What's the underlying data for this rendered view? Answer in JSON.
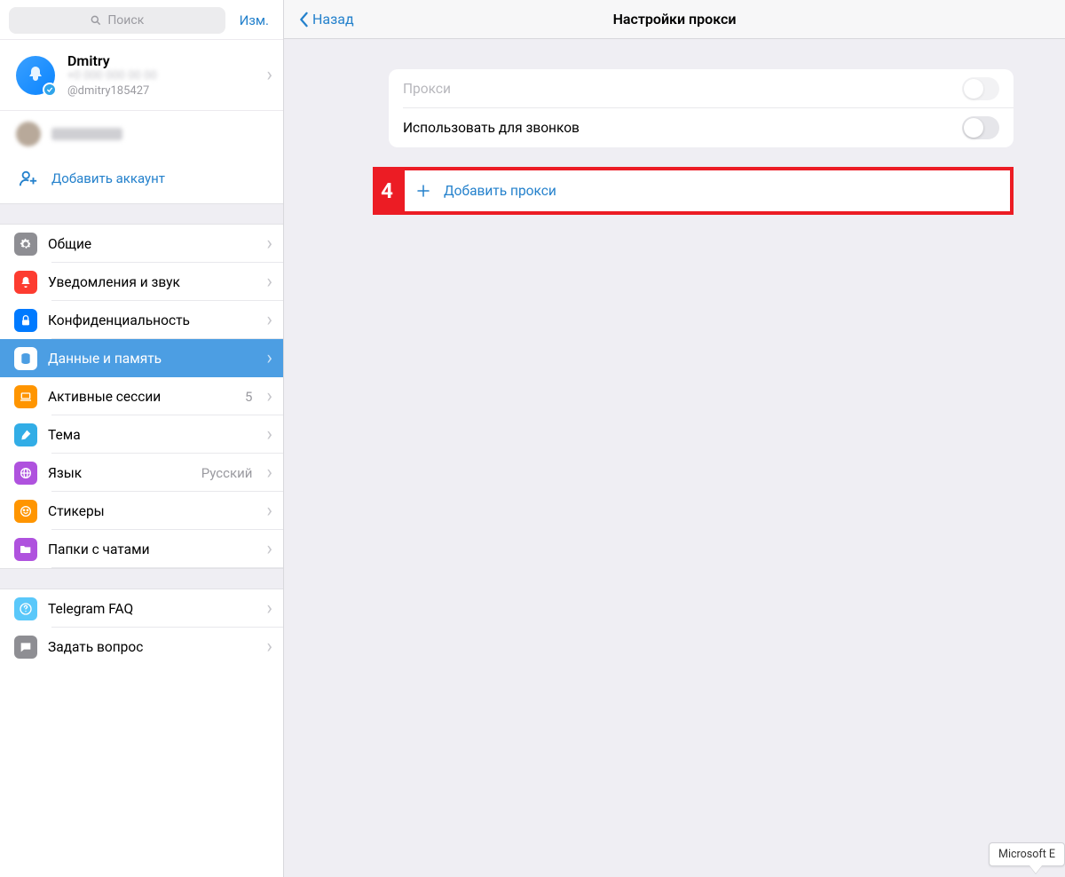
{
  "sidebar": {
    "search_placeholder": "Поиск",
    "edit_label": "Изм.",
    "profile": {
      "name": "Dmitry",
      "handle": "@dmitry185427"
    },
    "add_account_label": "Добавить аккаунт",
    "settings": [
      {
        "id": "general",
        "label": "Общие",
        "detail": "",
        "icon": "gear",
        "color": "gray"
      },
      {
        "id": "notif",
        "label": "Уведомления и звук",
        "detail": "",
        "icon": "bell",
        "color": "red"
      },
      {
        "id": "privacy",
        "label": "Конфиденциальность",
        "detail": "",
        "icon": "lock",
        "color": "blue"
      },
      {
        "id": "data",
        "label": "Данные и память",
        "detail": "",
        "icon": "db",
        "color": "selected",
        "selected": true
      },
      {
        "id": "sessions",
        "label": "Активные сессии",
        "detail": "5",
        "icon": "laptop",
        "color": "orange"
      },
      {
        "id": "theme",
        "label": "Тема",
        "detail": "",
        "icon": "brush",
        "color": "cyan"
      },
      {
        "id": "lang",
        "label": "Язык",
        "detail": "Русский",
        "icon": "globe",
        "color": "purple"
      },
      {
        "id": "stickers",
        "label": "Стикеры",
        "detail": "",
        "icon": "sticker",
        "color": "orange"
      },
      {
        "id": "folders",
        "label": "Папки с чатами",
        "detail": "",
        "icon": "folder",
        "color": "purple"
      }
    ],
    "support": [
      {
        "id": "faq",
        "label": "Telegram FAQ",
        "icon": "question",
        "color": "lightblue"
      },
      {
        "id": "ask",
        "label": "Задать вопрос",
        "icon": "chat",
        "color": "gray"
      }
    ]
  },
  "main": {
    "back_label": "Назад",
    "title": "Настройки прокси",
    "rows": {
      "proxy_label": "Прокси",
      "use_for_calls_label": "Использовать для звонков"
    },
    "add_proxy_label": "Добавить прокси",
    "callout_number": "4"
  },
  "tooltip": {
    "text": "Microsoft E"
  }
}
